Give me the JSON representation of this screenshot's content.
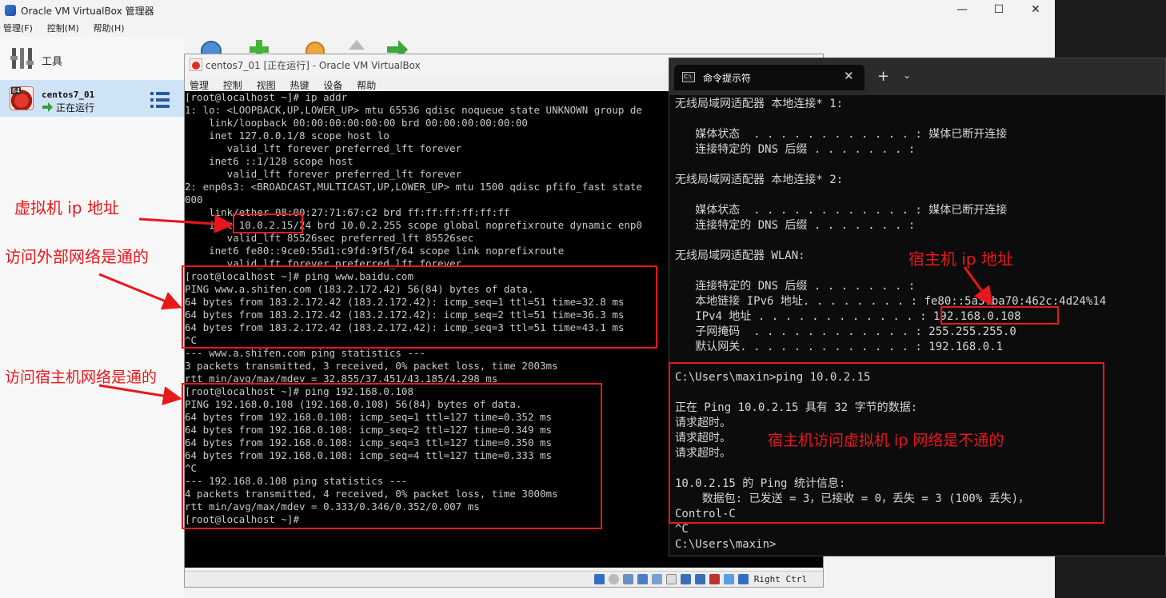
{
  "manager": {
    "title": "Oracle VM VirtualBox 管理器",
    "controls": {
      "minimize": "—",
      "maximize": "☐",
      "close": "✕"
    },
    "menu": [
      "管理(F)",
      "控制(M)",
      "帮助(H)"
    ],
    "tools_label": "工具",
    "vm": {
      "name": "centos7_01",
      "state": "正在运行",
      "arch_badge": "64"
    }
  },
  "vm_window": {
    "title": "centos7_01 [正在运行] - Oracle VM VirtualBox",
    "menu": [
      "管理",
      "控制",
      "视图",
      "热键",
      "设备",
      "帮助"
    ],
    "status_right": "Right Ctrl",
    "terminal": [
      "[root@localhost ~]# ip addr",
      "1: lo: <LOOPBACK,UP,LOWER_UP> mtu 65536 qdisc noqueue state UNKNOWN group de",
      "    link/loopback 00:00:00:00:00:00 brd 00:00:00:00:00:00",
      "    inet 127.0.0.1/8 scope host lo",
      "       valid_lft forever preferred_lft forever",
      "    inet6 ::1/128 scope host",
      "       valid_lft forever preferred_lft forever",
      "2: enp0s3: <BROADCAST,MULTICAST,UP,LOWER_UP> mtu 1500 qdisc pfifo_fast state",
      "000",
      "    link/ether 08:00:27:71:67:c2 brd ff:ff:ff:ff:ff:ff",
      "    inet 10.0.2.15/24 brd 10.0.2.255 scope global noprefixroute dynamic enp0",
      "       valid_lft 85526sec preferred_lft 85526sec",
      "    inet6 fe80::9ce0:55d1:c9fd:9f5f/64 scope link noprefixroute",
      "       valid_lft forever preferred_lft forever",
      "[root@localhost ~]# ping www.baidu.com",
      "PING www.a.shifen.com (183.2.172.42) 56(84) bytes of data.",
      "64 bytes from 183.2.172.42 (183.2.172.42): icmp_seq=1 ttl=51 time=32.8 ms",
      "64 bytes from 183.2.172.42 (183.2.172.42): icmp_seq=2 ttl=51 time=36.3 ms",
      "64 bytes from 183.2.172.42 (183.2.172.42): icmp_seq=3 ttl=51 time=43.1 ms",
      "^C",
      "--- www.a.shifen.com ping statistics ---",
      "3 packets transmitted, 3 received, 0% packet loss, time 2003ms",
      "rtt min/avg/max/mdev = 32.855/37.451/43.185/4.298 ms",
      "[root@localhost ~]# ping 192.168.0.108",
      "PING 192.168.0.108 (192.168.0.108) 56(84) bytes of data.",
      "64 bytes from 192.168.0.108: icmp_seq=1 ttl=127 time=0.352 ms",
      "64 bytes from 192.168.0.108: icmp_seq=2 ttl=127 time=0.349 ms",
      "64 bytes from 192.168.0.108: icmp_seq=3 ttl=127 time=0.350 ms",
      "64 bytes from 192.168.0.108: icmp_seq=4 ttl=127 time=0.333 ms",
      "^C",
      "--- 192.168.0.108 ping statistics ---",
      "4 packets transmitted, 4 received, 0% packet loss, time 3000ms",
      "rtt min/avg/max/mdev = 0.333/0.346/0.352/0.007 ms",
      "[root@localhost ~]#"
    ]
  },
  "cmd_window": {
    "tab_title": "命令提示符",
    "tab_icon": "C:\\",
    "close": "✕",
    "new_tab": "+",
    "dropdown": "⌄",
    "lines": [
      "无线局域网适配器 本地连接* 1:",
      "",
      "   媒体状态  . . . . . . . . . . . . : 媒体已断开连接",
      "   连接特定的 DNS 后缀 . . . . . . . :",
      "",
      "无线局域网适配器 本地连接* 2:",
      "",
      "   媒体状态  . . . . . . . . . . . . : 媒体已断开连接",
      "   连接特定的 DNS 后缀 . . . . . . . :",
      "",
      "无线局域网适配器 WLAN:",
      "",
      "   连接特定的 DNS 后缀 . . . . . . . :",
      "   本地链接 IPv6 地址. . . . . . . . : fe80::5a3:ba70:462c:4d24%14",
      "   IPv4 地址 . . . . . . . . . . . . : 192.168.0.108",
      "   子网掩码  . . . . . . . . . . . . : 255.255.255.0",
      "   默认网关. . . . . . . . . . . . . : 192.168.0.1",
      "",
      "C:\\Users\\maxin>ping 10.0.2.15",
      "",
      "正在 Ping 10.0.2.15 具有 32 字节的数据:",
      "请求超时。",
      "请求超时。",
      "请求超时。",
      "",
      "10.0.2.15 的 Ping 统计信息:",
      "    数据包: 已发送 = 3，已接收 = 0，丢失 = 3 (100% 丢失)，",
      "Control-C",
      "^C",
      "C:\\Users\\maxin>"
    ]
  },
  "annotations": {
    "vm_ip": "虚拟机 ip 地址",
    "external_ok": "访问外部网络是通的",
    "host_ok": "访问宿主机网络是通的",
    "host_ip": "宿主机 ip 地址",
    "host_to_vm_fail": "宿主机访问虚拟机 ip 网络是不通的",
    "color": "#e8171c"
  }
}
